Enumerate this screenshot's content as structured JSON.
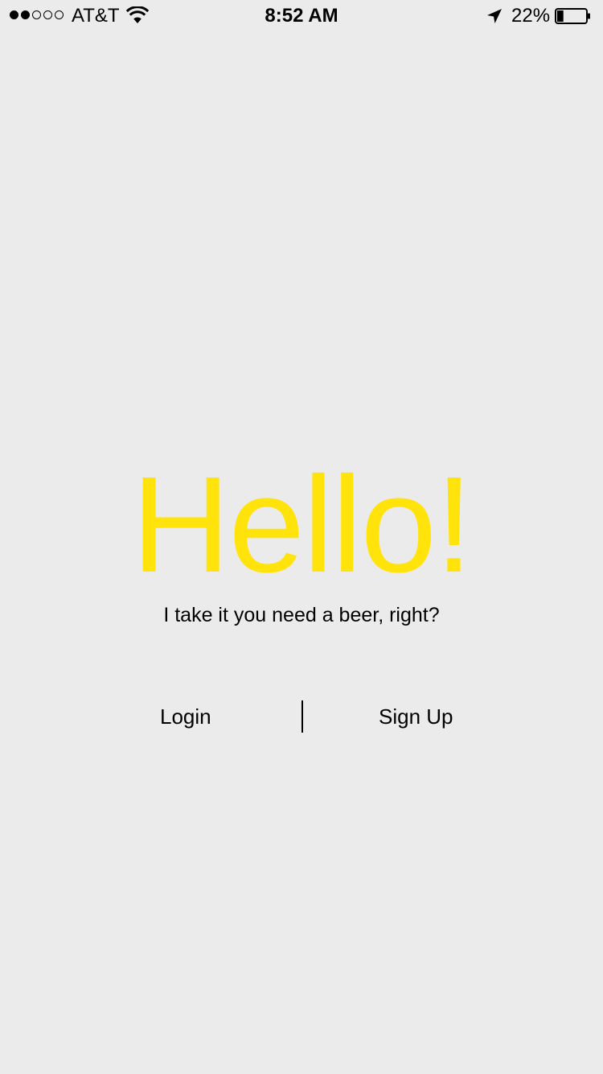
{
  "status_bar": {
    "carrier": "AT&T",
    "time": "8:52 AM",
    "battery_percent": "22%",
    "battery_level": 0.22,
    "signal_bars_filled": 2,
    "signal_bars_total": 5,
    "icons": [
      "wifi-icon",
      "location-arrow-icon",
      "battery-icon"
    ]
  },
  "main": {
    "title": "Hello!",
    "subtitle": "I take it you need a beer, right?",
    "login_label": "Login",
    "signup_label": "Sign Up"
  },
  "colors": {
    "background": "#ebebeb",
    "title": "#ffe30a",
    "text": "#000000"
  }
}
